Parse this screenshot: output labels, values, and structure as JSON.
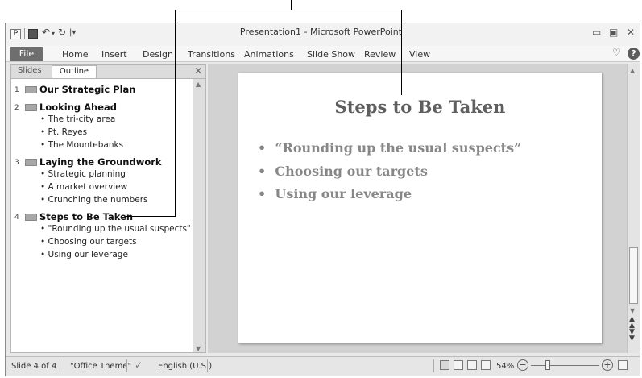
{
  "window": {
    "title": "Presentation1 - Microsoft PowerPoint",
    "app_icon_letter": "P",
    "minimize_glyph": "▭",
    "maximize_glyph": "▣",
    "close_glyph": "✕"
  },
  "quick_access": {
    "undo_glyph": "↶",
    "redo_glyph": "↻",
    "dropdown_glyph": "▾",
    "customize_glyph": "|▾"
  },
  "ribbon": {
    "file_tab": "File",
    "tabs": [
      "Home",
      "Insert",
      "Design",
      "Transitions",
      "Animations",
      "Slide Show",
      "Review",
      "View"
    ],
    "collapse_glyph": "♡",
    "help_glyph": "?"
  },
  "left_pane": {
    "tabs": [
      "Slides",
      "Outline"
    ],
    "active_tab": "Outline",
    "close_glyph": "✕",
    "outline": [
      {
        "number": "1",
        "title": "Our Strategic Plan",
        "bullets": []
      },
      {
        "number": "2",
        "title": "Looking Ahead",
        "bullets": [
          "The tri-city area",
          "Pt. Reyes",
          "The Mountebanks"
        ]
      },
      {
        "number": "3",
        "title": "Laying the Groundwork",
        "bullets": [
          "Strategic planning",
          "A market overview",
          "Crunching the numbers"
        ]
      },
      {
        "number": "4",
        "title": "Steps to Be Taken",
        "bullets": [
          "\"Rounding up the usual suspects\"",
          "Choosing our targets",
          "Using our leverage"
        ]
      }
    ]
  },
  "slide": {
    "title": "Steps to Be Taken",
    "bullets": [
      "“Rounding up the usual suspects”",
      "Choosing our targets",
      "Using our leverage"
    ],
    "bullet_char": "•"
  },
  "status_bar": {
    "slide_indicator": "Slide 4 of 4",
    "theme": "\"Office Theme\"",
    "language": "English (U.S.)",
    "zoom": "54%",
    "zoom_out_glyph": "−",
    "zoom_in_glyph": "+"
  },
  "colors": {
    "file_tab": "#6e6e6e",
    "slide_title": "#5f5f5f",
    "slide_bullets": "#878787",
    "workspace": "#d2d2d2"
  }
}
